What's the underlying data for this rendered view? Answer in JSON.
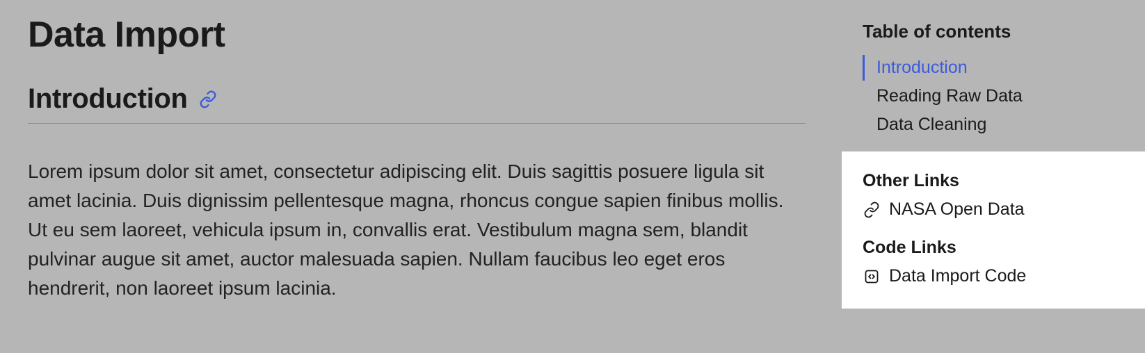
{
  "main": {
    "title": "Data Import",
    "section_heading": "Introduction",
    "body": "Lorem ipsum dolor sit amet, consectetur adipiscing elit. Duis sagittis posuere ligula sit amet lacinia. Duis dignissim pellentesque magna, rhoncus congue sapien finibus mollis. Ut eu sem laoreet, vehicula ipsum in, convallis erat. Vestibulum magna sem, blandit pulvinar augue sit amet, auctor malesuada sapien. Nullam faucibus leo eget eros hendrerit, non laoreet ipsum lacinia."
  },
  "sidebar": {
    "toc": {
      "title": "Table of contents",
      "items": [
        {
          "label": "Introduction",
          "active": true
        },
        {
          "label": "Reading Raw Data",
          "active": false
        },
        {
          "label": "Data Cleaning",
          "active": false
        }
      ]
    },
    "other_links": {
      "title": "Other Links",
      "items": [
        {
          "label": "NASA Open Data"
        }
      ]
    },
    "code_links": {
      "title": "Code Links",
      "items": [
        {
          "label": "Data Import Code"
        }
      ]
    }
  },
  "colors": {
    "accent": "#3b5bdb"
  }
}
